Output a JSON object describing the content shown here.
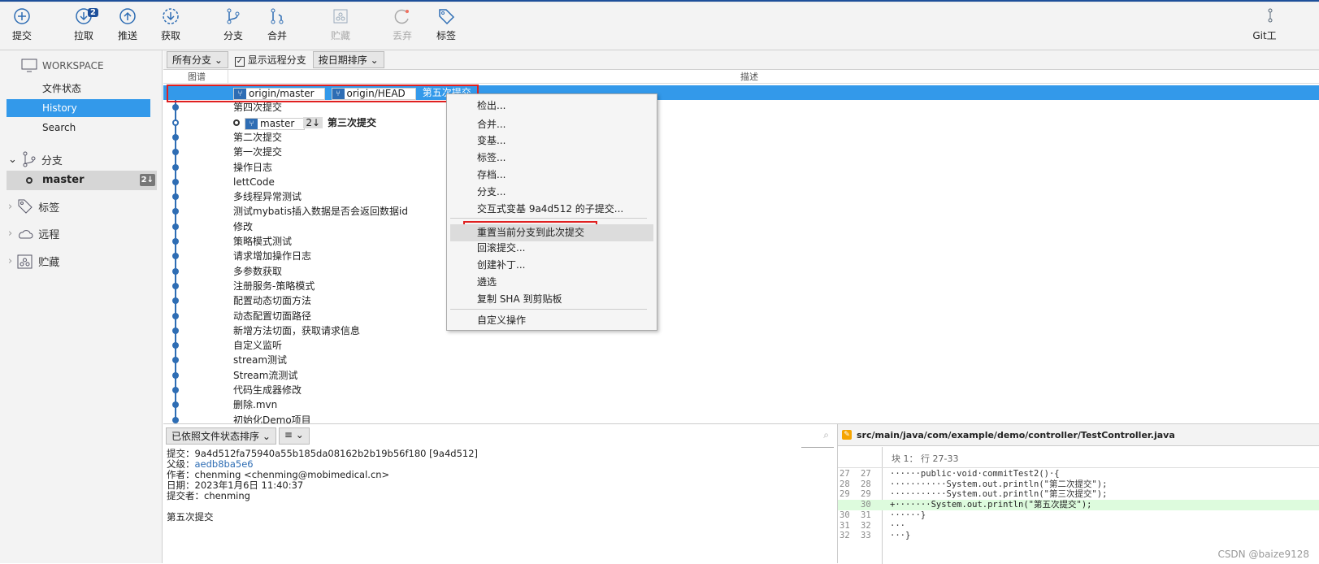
{
  "toolbar": {
    "commit": "提交",
    "pull": "拉取",
    "pull_badge": "2",
    "push": "推送",
    "fetch": "获取",
    "branch": "分支",
    "merge": "合并",
    "stash": "贮藏",
    "discard": "丢弃",
    "tag": "标签",
    "gitflow": "Git工"
  },
  "sidebar": {
    "workspace": "WORKSPACE",
    "items": [
      "文件状态",
      "History",
      "Search"
    ],
    "branches": "分支",
    "master": "master",
    "master_badge": "2↓",
    "tags": "标签",
    "remotes": "远程",
    "stashes": "贮藏"
  },
  "filter": {
    "branches": "所有分支",
    "show_remote": "显示远程分支",
    "show_remote_checked": true,
    "sort": "按日期排序"
  },
  "columns": {
    "graph": "图谱",
    "desc": "描述"
  },
  "commits": [
    {
      "refs": [
        "origin/master",
        "origin/HEAD"
      ],
      "msg": "第五次提交"
    },
    {
      "msg": "第四次提交"
    },
    {
      "refs": [
        "master"
      ],
      "behind": "2↓",
      "msg": "第三次提交"
    },
    {
      "msg": "第二次提交"
    },
    {
      "msg": "第一次提交"
    },
    {
      "msg": "操作日志"
    },
    {
      "msg": "lettCode"
    },
    {
      "msg": "多线程异常测试"
    },
    {
      "msg": "测试mybatis插入数据是否会返回数据id"
    },
    {
      "msg": "修改"
    },
    {
      "msg": "策略模式测试"
    },
    {
      "msg": "请求增加操作日志"
    },
    {
      "msg": "多参数获取"
    },
    {
      "msg": "注册服务-策略模式"
    },
    {
      "msg": "配置动态切面方法"
    },
    {
      "msg": "动态配置切面路径"
    },
    {
      "msg": "新增方法切面，获取请求信息"
    },
    {
      "msg": "自定义监听"
    },
    {
      "msg": "stream测试"
    },
    {
      "msg": "Stream流测试"
    },
    {
      "msg": "代码生成器修改"
    },
    {
      "msg": "删除.mvn"
    },
    {
      "msg": "初始化Demo项目"
    }
  ],
  "context_menu": {
    "items": [
      "检出...",
      "合并...",
      "变基...",
      "标签...",
      "存档...",
      "分支...",
      "交互式变基 9a4d512 的子提交...",
      "重置当前分支到此次提交",
      "回滚提交...",
      "创建补丁...",
      "遴选",
      "复制 SHA 到剪贴板",
      "自定义操作"
    ],
    "highlighted": "重置当前分支到此次提交"
  },
  "details": {
    "sort": "已依照文件状态排序",
    "commit_label": "提交：",
    "commit": "9a4d512fa75940a55b185da08162b2b19b56f180 [9a4d512]",
    "parent_label": "父级：",
    "parent": "aedb8ba5e6",
    "author_label": "作者：",
    "author": "chenming <chenming@mobimedical.cn>",
    "date_label": "日期：",
    "date": "2023年1月6日 11:40:37",
    "committer_label": "提交者：",
    "committer": "chenming",
    "message": "第五次提交"
  },
  "diff": {
    "file": "src/main/java/com/example/demo/controller/TestController.java",
    "hunk": "块 1： 行 27-33",
    "lines": [
      {
        "old": "27",
        "new": "27",
        "text": "······public·void·commitTest2()·{"
      },
      {
        "old": "28",
        "new": "28",
        "text": "···········System.out.println(\"第二次提交\");"
      },
      {
        "old": "29",
        "new": "29",
        "text": "···········System.out.println(\"第三次提交\");"
      },
      {
        "old": "",
        "new": "30",
        "text": "+·······System.out.println(\"第五次提交\");",
        "added": true
      },
      {
        "old": "30",
        "new": "31",
        "text": "······}"
      },
      {
        "old": "31",
        "new": "32",
        "text": "···"
      },
      {
        "old": "32",
        "new": "33",
        "text": "···}"
      }
    ]
  },
  "watermark": "CSDN @baize9128"
}
